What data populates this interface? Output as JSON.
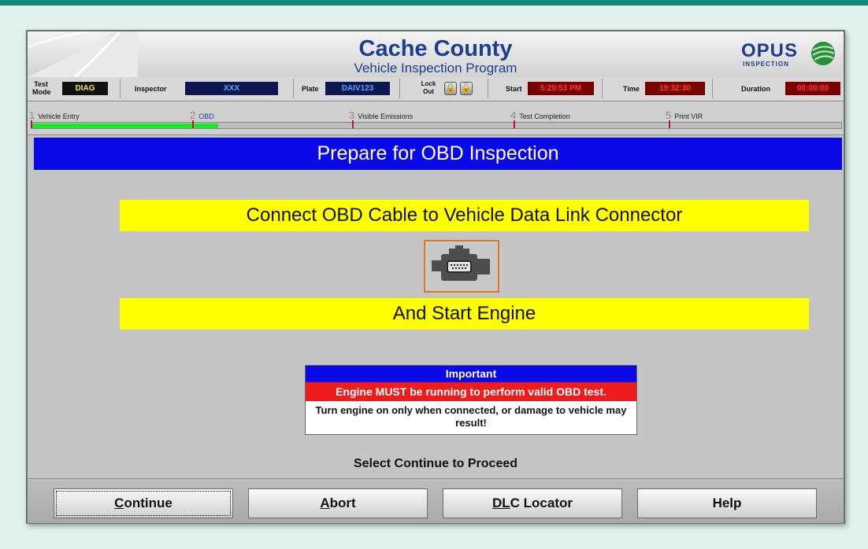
{
  "header": {
    "title": "Cache County",
    "subtitle": "Vehicle Inspection Program",
    "logo_text": "OPUS",
    "logo_sub": "INSPECTION"
  },
  "info": {
    "test_mode_label": "Test Mode",
    "test_mode_value": "DIAG",
    "inspector_label": "Inspector",
    "inspector_value": "XXX",
    "plate_label": "Plate",
    "plate_value": "DAIV123",
    "lockout_label": "Lock Out",
    "start_label": "Start",
    "start_value": "5:20:53 PM",
    "time_label": "Time",
    "time_value": "19:32:30",
    "duration_label": "Duration",
    "duration_value": "00:00:00"
  },
  "progress": {
    "steps": [
      {
        "num": "1",
        "label": "Vehicle Entry"
      },
      {
        "num": "2",
        "label": "OBD"
      },
      {
        "num": "3",
        "label": "Visible Emissions"
      },
      {
        "num": "4",
        "label": "Test Completion"
      },
      {
        "num": "5",
        "label": "Print VIR"
      }
    ],
    "active_step": 2
  },
  "main": {
    "banner": "Prepare for OBD Inspection",
    "instruction_1": "Connect OBD Cable to Vehicle Data Link Connector",
    "instruction_2": "And Start Engine",
    "engine_icon": "engine-icon",
    "important": {
      "heading": "Important",
      "warning": "Engine MUST be running to perform valid OBD test.",
      "note": "Turn engine on only when connected, or damage to vehicle may result!"
    },
    "proceed_text": "Select Continue to Proceed"
  },
  "buttons": {
    "continue": {
      "underline": "C",
      "rest": "ontinue"
    },
    "abort": {
      "underline": "A",
      "rest": "bort"
    },
    "dlc": {
      "underline": "DL",
      "rest": "C Locator"
    },
    "help": {
      "label": "Help"
    }
  },
  "colors": {
    "banner_blue": "#0a0ae8",
    "instruction_yellow": "#ffff00",
    "progress_green": "#18e82a",
    "title_blue": "#1d3f8c"
  }
}
